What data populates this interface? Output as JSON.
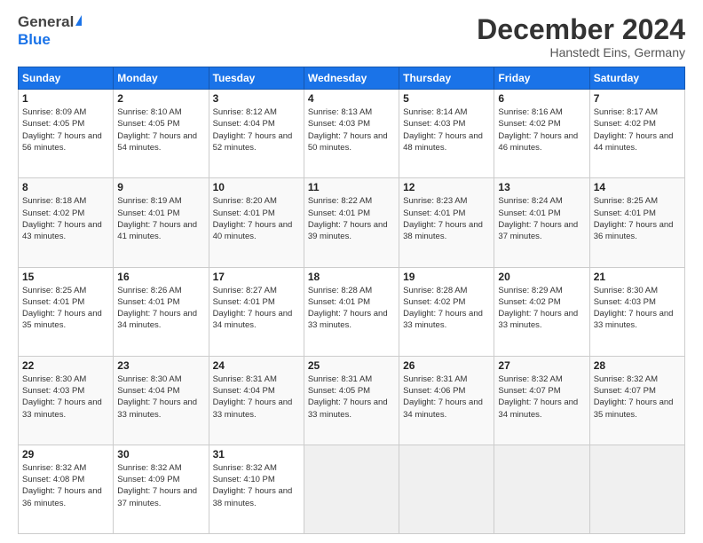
{
  "header": {
    "logo_general": "General",
    "logo_blue": "Blue",
    "title": "December 2024",
    "subtitle": "Hanstedt Eins, Germany"
  },
  "days_of_week": [
    "Sunday",
    "Monday",
    "Tuesday",
    "Wednesday",
    "Thursday",
    "Friday",
    "Saturday"
  ],
  "weeks": [
    [
      {
        "day": "1",
        "sunrise": "Sunrise: 8:09 AM",
        "sunset": "Sunset: 4:05 PM",
        "daylight": "Daylight: 7 hours and 56 minutes."
      },
      {
        "day": "2",
        "sunrise": "Sunrise: 8:10 AM",
        "sunset": "Sunset: 4:05 PM",
        "daylight": "Daylight: 7 hours and 54 minutes."
      },
      {
        "day": "3",
        "sunrise": "Sunrise: 8:12 AM",
        "sunset": "Sunset: 4:04 PM",
        "daylight": "Daylight: 7 hours and 52 minutes."
      },
      {
        "day": "4",
        "sunrise": "Sunrise: 8:13 AM",
        "sunset": "Sunset: 4:03 PM",
        "daylight": "Daylight: 7 hours and 50 minutes."
      },
      {
        "day": "5",
        "sunrise": "Sunrise: 8:14 AM",
        "sunset": "Sunset: 4:03 PM",
        "daylight": "Daylight: 7 hours and 48 minutes."
      },
      {
        "day": "6",
        "sunrise": "Sunrise: 8:16 AM",
        "sunset": "Sunset: 4:02 PM",
        "daylight": "Daylight: 7 hours and 46 minutes."
      },
      {
        "day": "7",
        "sunrise": "Sunrise: 8:17 AM",
        "sunset": "Sunset: 4:02 PM",
        "daylight": "Daylight: 7 hours and 44 minutes."
      }
    ],
    [
      {
        "day": "8",
        "sunrise": "Sunrise: 8:18 AM",
        "sunset": "Sunset: 4:02 PM",
        "daylight": "Daylight: 7 hours and 43 minutes."
      },
      {
        "day": "9",
        "sunrise": "Sunrise: 8:19 AM",
        "sunset": "Sunset: 4:01 PM",
        "daylight": "Daylight: 7 hours and 41 minutes."
      },
      {
        "day": "10",
        "sunrise": "Sunrise: 8:20 AM",
        "sunset": "Sunset: 4:01 PM",
        "daylight": "Daylight: 7 hours and 40 minutes."
      },
      {
        "day": "11",
        "sunrise": "Sunrise: 8:22 AM",
        "sunset": "Sunset: 4:01 PM",
        "daylight": "Daylight: 7 hours and 39 minutes."
      },
      {
        "day": "12",
        "sunrise": "Sunrise: 8:23 AM",
        "sunset": "Sunset: 4:01 PM",
        "daylight": "Daylight: 7 hours and 38 minutes."
      },
      {
        "day": "13",
        "sunrise": "Sunrise: 8:24 AM",
        "sunset": "Sunset: 4:01 PM",
        "daylight": "Daylight: 7 hours and 37 minutes."
      },
      {
        "day": "14",
        "sunrise": "Sunrise: 8:25 AM",
        "sunset": "Sunset: 4:01 PM",
        "daylight": "Daylight: 7 hours and 36 minutes."
      }
    ],
    [
      {
        "day": "15",
        "sunrise": "Sunrise: 8:25 AM",
        "sunset": "Sunset: 4:01 PM",
        "daylight": "Daylight: 7 hours and 35 minutes."
      },
      {
        "day": "16",
        "sunrise": "Sunrise: 8:26 AM",
        "sunset": "Sunset: 4:01 PM",
        "daylight": "Daylight: 7 hours and 34 minutes."
      },
      {
        "day": "17",
        "sunrise": "Sunrise: 8:27 AM",
        "sunset": "Sunset: 4:01 PM",
        "daylight": "Daylight: 7 hours and 34 minutes."
      },
      {
        "day": "18",
        "sunrise": "Sunrise: 8:28 AM",
        "sunset": "Sunset: 4:01 PM",
        "daylight": "Daylight: 7 hours and 33 minutes."
      },
      {
        "day": "19",
        "sunrise": "Sunrise: 8:28 AM",
        "sunset": "Sunset: 4:02 PM",
        "daylight": "Daylight: 7 hours and 33 minutes."
      },
      {
        "day": "20",
        "sunrise": "Sunrise: 8:29 AM",
        "sunset": "Sunset: 4:02 PM",
        "daylight": "Daylight: 7 hours and 33 minutes."
      },
      {
        "day": "21",
        "sunrise": "Sunrise: 8:30 AM",
        "sunset": "Sunset: 4:03 PM",
        "daylight": "Daylight: 7 hours and 33 minutes."
      }
    ],
    [
      {
        "day": "22",
        "sunrise": "Sunrise: 8:30 AM",
        "sunset": "Sunset: 4:03 PM",
        "daylight": "Daylight: 7 hours and 33 minutes."
      },
      {
        "day": "23",
        "sunrise": "Sunrise: 8:30 AM",
        "sunset": "Sunset: 4:04 PM",
        "daylight": "Daylight: 7 hours and 33 minutes."
      },
      {
        "day": "24",
        "sunrise": "Sunrise: 8:31 AM",
        "sunset": "Sunset: 4:04 PM",
        "daylight": "Daylight: 7 hours and 33 minutes."
      },
      {
        "day": "25",
        "sunrise": "Sunrise: 8:31 AM",
        "sunset": "Sunset: 4:05 PM",
        "daylight": "Daylight: 7 hours and 33 minutes."
      },
      {
        "day": "26",
        "sunrise": "Sunrise: 8:31 AM",
        "sunset": "Sunset: 4:06 PM",
        "daylight": "Daylight: 7 hours and 34 minutes."
      },
      {
        "day": "27",
        "sunrise": "Sunrise: 8:32 AM",
        "sunset": "Sunset: 4:07 PM",
        "daylight": "Daylight: 7 hours and 34 minutes."
      },
      {
        "day": "28",
        "sunrise": "Sunrise: 8:32 AM",
        "sunset": "Sunset: 4:07 PM",
        "daylight": "Daylight: 7 hours and 35 minutes."
      }
    ],
    [
      {
        "day": "29",
        "sunrise": "Sunrise: 8:32 AM",
        "sunset": "Sunset: 4:08 PM",
        "daylight": "Daylight: 7 hours and 36 minutes."
      },
      {
        "day": "30",
        "sunrise": "Sunrise: 8:32 AM",
        "sunset": "Sunset: 4:09 PM",
        "daylight": "Daylight: 7 hours and 37 minutes."
      },
      {
        "day": "31",
        "sunrise": "Sunrise: 8:32 AM",
        "sunset": "Sunset: 4:10 PM",
        "daylight": "Daylight: 7 hours and 38 minutes."
      },
      null,
      null,
      null,
      null
    ]
  ]
}
